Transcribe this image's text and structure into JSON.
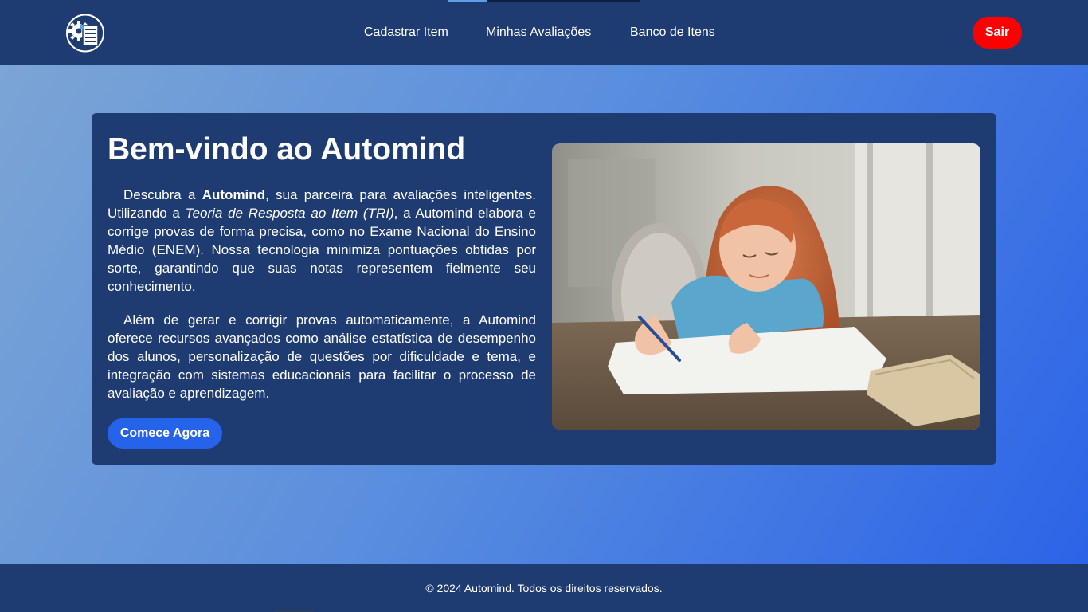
{
  "nav": {
    "logo_icon": "document-gear-icon",
    "links": [
      {
        "label": "Cadastrar Item"
      },
      {
        "label": "Minhas Avaliações"
      },
      {
        "label": "Banco de Itens"
      }
    ],
    "logout_label": "Sair"
  },
  "hero": {
    "title": "Bem-vindo ao Automind",
    "p1": {
      "s1": "Descubra a ",
      "brand": "Automind",
      "s2": ", sua parceira para avaliações inteligentes. Utilizando a ",
      "tri": "Teoria de Resposta ao Item (TRI)",
      "s3": ", a Automind elabora e corrige provas de forma precisa, como no Exame Nacional do Ensino Médio (ENEM). Nossa tecnologia minimiza pontuações obtidas por sorte, garantindo que suas notas representem fielmente seu conhecimento."
    },
    "p2": "Além de gerar e corrigir provas automaticamente, a Automind oferece recursos avançados como análise estatística de desempenho dos alunos, personalização de questões por dificuldade e tema, e integração com sistemas educacionais para facilitar o processo de avaliação e aprendizagem.",
    "cta_label": "Comece Agora"
  },
  "footer": {
    "text": "© 2024 Automind. Todos os direitos reservados."
  },
  "colors": {
    "navbar": "#1e3c72",
    "card": "#1e3c72",
    "logout": "#ff0000",
    "cta": "#2563eb"
  }
}
